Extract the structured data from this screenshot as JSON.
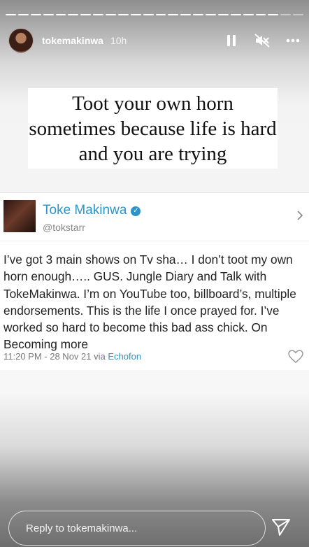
{
  "story": {
    "progress": {
      "segments": 24,
      "completed": 22
    },
    "user": {
      "username": "tokemakinwa",
      "time": "10h"
    },
    "controls": [
      "pause-icon",
      "mute-icon",
      "more-icon"
    ],
    "headline": "Toot your own horn sometimes because life is hard and you are trying"
  },
  "tweet": {
    "name": "Toke Makinwa",
    "verified_icon": "✓",
    "handle": "@tokstarr",
    "text": "I’ve got 3 main shows on Tv sha… I don’t toot my own horn enough….. GUS. Jungle Diary and Talk with TokeMakinwa. I’m on YouTube too, billboard’s, multiple endorsements. This is the life I once prayed for. I’ve worked so hard to become this bad ass chick. On Becoming more",
    "meta_time": "11:20 PM - 28 Nov 21 via ",
    "meta_client": "Echofon"
  },
  "reply": {
    "placeholder": "Reply to tokemakinwa..."
  },
  "colors": {
    "link": "#2b94c8"
  }
}
